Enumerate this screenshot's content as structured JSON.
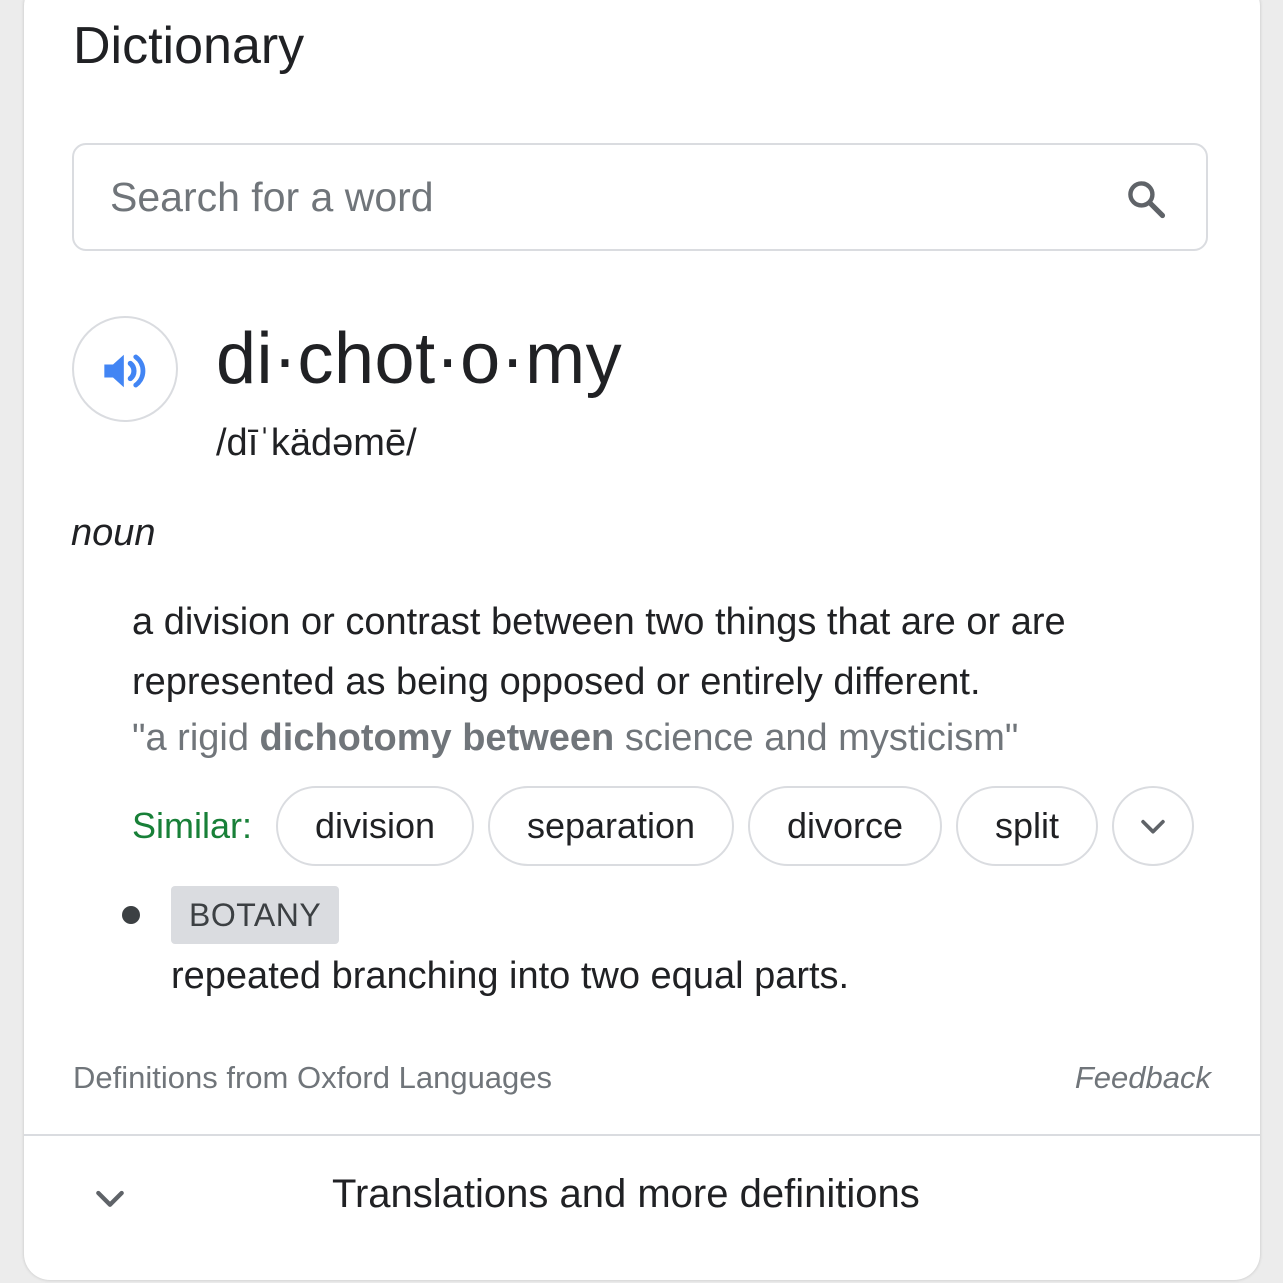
{
  "card": {
    "heading": "Dictionary",
    "search": {
      "placeholder": "Search for a word",
      "value": ""
    },
    "entry": {
      "word": "di·chot·o·my",
      "phonetic": "/dīˈkädəmē/",
      "part_of_speech": "noun",
      "definition": "a division or contrast between two things that are or are represented as being opposed or entirely different.",
      "example": {
        "prefix": "\"a rigid ",
        "bold": "dichotomy between",
        "suffix": " science and mysticism\""
      },
      "similar_label": "Similar:",
      "similar": [
        "division",
        "separation",
        "divorce",
        "split"
      ],
      "sense2": {
        "label": "BOTANY",
        "definition": "repeated branching into two equal parts."
      }
    },
    "footer": {
      "source": "Definitions from Oxford Languages",
      "feedback": "Feedback"
    },
    "more": {
      "label": "Translations and more definitions"
    }
  },
  "colors": {
    "accent_blue": "#4285f4",
    "similar_green": "#188038",
    "muted_text": "#70757a",
    "border": "#dadce0"
  },
  "icons": [
    "search-icon",
    "speaker-icon",
    "chevron-down-icon"
  ]
}
